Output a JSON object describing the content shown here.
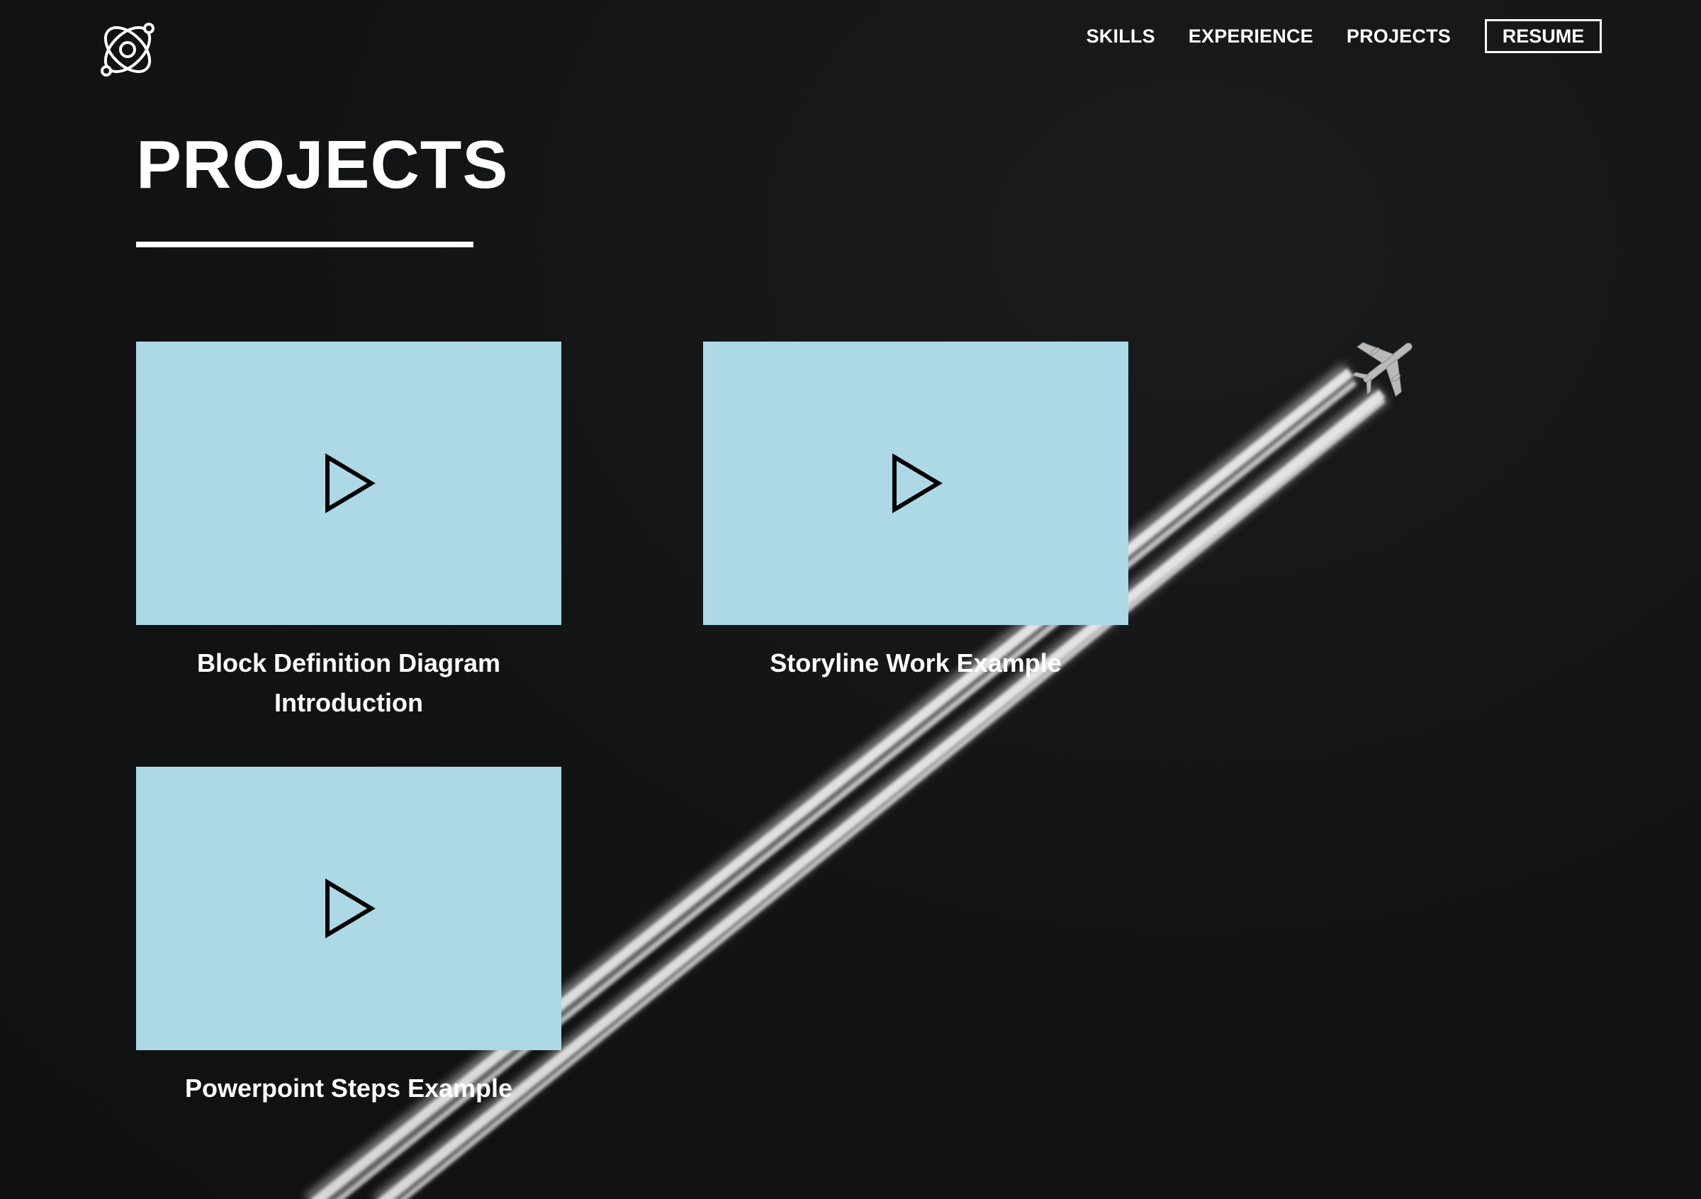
{
  "nav": {
    "logo_icon": "atom-orbit-icon",
    "links": [
      "SKILLS",
      "EXPERIENCE",
      "PROJECTS"
    ],
    "resume_label": "RESUME"
  },
  "section": {
    "title": "PROJECTS"
  },
  "projects": [
    {
      "title": "Block Definition Diagram Introduction",
      "icon": "play-icon",
      "thumb_color": "#add8e6"
    },
    {
      "title": "Storyline Work Example",
      "icon": "play-icon",
      "thumb_color": "#add8e6"
    },
    {
      "title": "Powerpoint Steps Example",
      "icon": "play-icon",
      "thumb_color": "#add8e6"
    }
  ],
  "colors": {
    "background": "#121314",
    "text": "#ffffff",
    "thumbnail": "#add8e6"
  }
}
